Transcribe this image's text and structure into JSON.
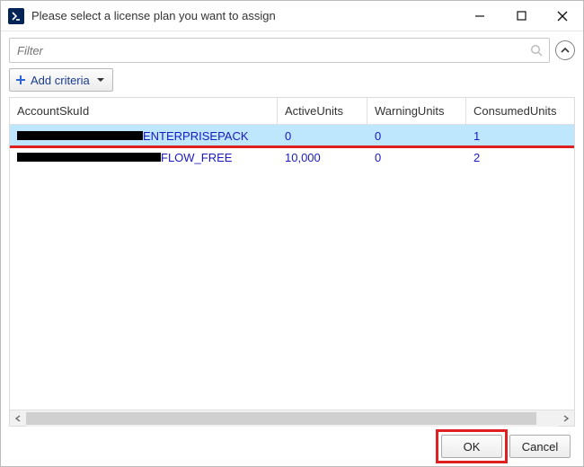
{
  "window": {
    "title": "Please select a license plan you want to assign"
  },
  "filter": {
    "placeholder": "Filter"
  },
  "criteria": {
    "add_label": "Add criteria"
  },
  "grid": {
    "headers": {
      "sku": "AccountSkuId",
      "active": "ActiveUnits",
      "warning": "WarningUnits",
      "consumed": "ConsumedUnits"
    },
    "rows": {
      "0": {
        "sku_suffix": "ENTERPRISEPACK",
        "active": "0",
        "warning": "0",
        "consumed": "1"
      },
      "1": {
        "sku_suffix": "FLOW_FREE",
        "active": "10,000",
        "warning": "0",
        "consumed": "2"
      }
    }
  },
  "buttons": {
    "ok": "OK",
    "cancel": "Cancel"
  }
}
